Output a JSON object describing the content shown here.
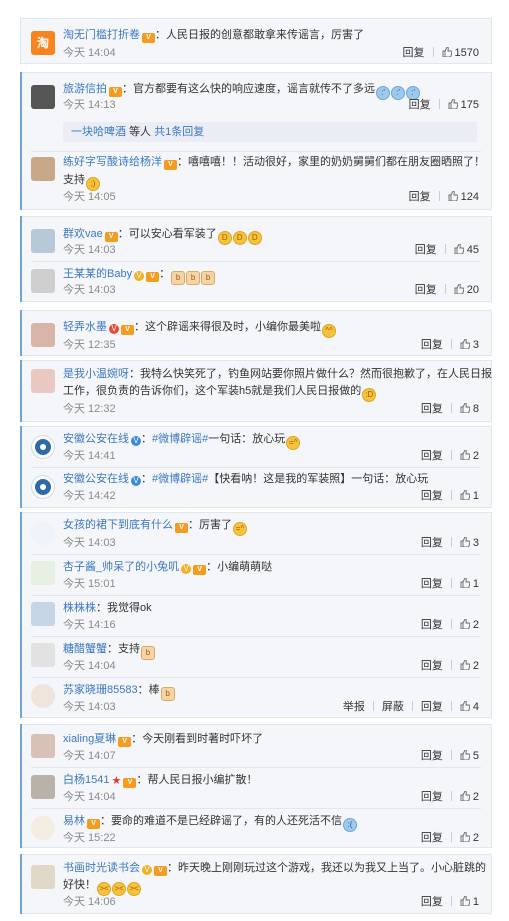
{
  "action_labels": {
    "reply": "回复",
    "report": "举报",
    "block": "屏蔽"
  },
  "colors": {
    "link": "#3d78c0",
    "accent_bar": "#6fa6d6",
    "time": "#8a8a8a",
    "card_bg": "#f4f6fa"
  },
  "c1": {
    "user": "淘无门槛打折卷",
    "avatar_text": "淘",
    "badge": "crown",
    "text": "：人民日报的创意都敢拿来传谣言，厉害了",
    "time": "今天 14:04",
    "likes": "1570"
  },
  "c2": {
    "user": "旅游信拍",
    "text": "：官方都要有这么快的响应速度，谣言就传不了多远",
    "time": "今天 14:13",
    "likes": "175",
    "reply_bar": {
      "user": "一块哈啤酒",
      "mid": " 等人 ",
      "link": "共1条回复"
    }
  },
  "c3": {
    "user": "练好字写酸诗给杨洋",
    "text": "：嘻嘻嘻！！活动很好，家里的奶奶舅舅们都在朋友圈晒照了！",
    "text2": "支持",
    "time": "今天 14:05",
    "likes": "124"
  },
  "c4": {
    "user": "群欢vae",
    "text": "：可以安心看军装了",
    "time": "今天 14:03",
    "likes": "45"
  },
  "c5": {
    "user": "王某某的Baby",
    "text": "：",
    "time": "今天 14:03",
    "likes": "20"
  },
  "c6": {
    "user": "轻弄水墨",
    "text": "：这个辟谣来得很及时，小编你最美啦",
    "time": "今天 12:35",
    "likes": "3"
  },
  "c7": {
    "user": "是我小温婉呀",
    "text": "：我特么快笑死了，钓鱼网站要你照片做什么？然而很抱歉了，在人民日报",
    "text2": "工作，很负责的告诉你们，这个军装h5就是我们人民日报做的",
    "time": "今天 12:32",
    "likes": "8"
  },
  "c8": {
    "user": "安徽公安在线",
    "tag": "#微博辟谣#",
    "text": "一句话：放心玩",
    "time": "今天 14:41",
    "likes": "2"
  },
  "c9": {
    "user": "安徽公安在线",
    "tag": "#微博辟谣#",
    "text": "【快看呐！这是我的军装照】一句话：放心玩",
    "time": "今天 14:42",
    "likes": "1"
  },
  "c10": {
    "user": "女孩的裙下到底有什么",
    "text": "：厉害了",
    "time": "今天 14:03",
    "likes": "3"
  },
  "c11": {
    "user": "杏子酱_帅呆了的小兔叽",
    "text": "：小编萌萌哒",
    "time": "今天 15:01",
    "likes": "1"
  },
  "c12": {
    "user": "株株株",
    "text": "：我觉得ok",
    "time": "今天 14:16",
    "likes": "2"
  },
  "c13": {
    "user": "糖醋蟹蟹",
    "text": "：支持",
    "time": "今天 14:04",
    "likes": "2"
  },
  "c14": {
    "user": "苏家晓珊85583",
    "text": "：棒",
    "time": "今天 14:03",
    "likes": "4"
  },
  "c15": {
    "user": "xialing夏琳",
    "text": "：今天刚看到时著时吓坏了",
    "time": "今天 14:07",
    "likes": "5"
  },
  "c16": {
    "user": "白杨1541",
    "text": "：帮人民日报小编扩散！",
    "time": "今天 14:04",
    "likes": "2"
  },
  "c17": {
    "user": "易林",
    "text": "：要命的难道不是已经辟谣了，有的人还死活不信",
    "time": "今天 15:22",
    "likes": "2"
  },
  "c18": {
    "user": "书画时光读书会",
    "text": "：昨天晚上刚刚玩过这个游戏，我还以为我又上当了。小心脏跳的",
    "text2": "好快！",
    "time": "今天 14:06",
    "likes": "1"
  }
}
